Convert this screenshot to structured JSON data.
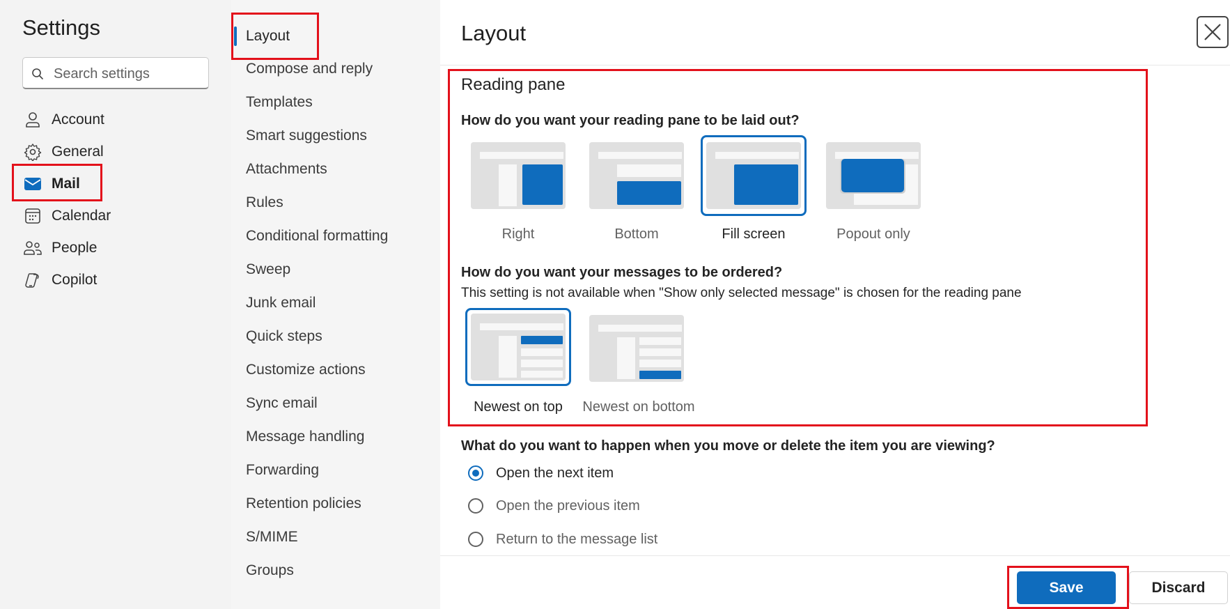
{
  "settings": {
    "title": "Settings",
    "search_placeholder": "Search settings",
    "nav": [
      {
        "label": "Account",
        "icon": "person-icon"
      },
      {
        "label": "General",
        "icon": "gear-icon"
      },
      {
        "label": "Mail",
        "icon": "mail-icon",
        "selected": true
      },
      {
        "label": "Calendar",
        "icon": "calendar-icon"
      },
      {
        "label": "People",
        "icon": "people-icon"
      },
      {
        "label": "Copilot",
        "icon": "copilot-icon"
      }
    ]
  },
  "mail_nav": {
    "items": [
      {
        "label": "Layout",
        "selected": true
      },
      {
        "label": "Compose and reply"
      },
      {
        "label": "Templates"
      },
      {
        "label": "Smart suggestions"
      },
      {
        "label": "Attachments"
      },
      {
        "label": "Rules"
      },
      {
        "label": "Conditional formatting"
      },
      {
        "label": "Sweep"
      },
      {
        "label": "Junk email"
      },
      {
        "label": "Quick steps"
      },
      {
        "label": "Customize actions"
      },
      {
        "label": "Sync email"
      },
      {
        "label": "Message handling"
      },
      {
        "label": "Forwarding"
      },
      {
        "label": "Retention policies"
      },
      {
        "label": "S/MIME"
      },
      {
        "label": "Groups"
      }
    ]
  },
  "main": {
    "title": "Layout",
    "close_icon": "close-icon",
    "reading_pane": {
      "section_title": "Reading pane",
      "layout_question": "How do you want your reading pane to be laid out?",
      "layout_options": [
        {
          "label": "Right",
          "selected": false
        },
        {
          "label": "Bottom",
          "selected": false
        },
        {
          "label": "Fill screen",
          "selected": true
        },
        {
          "label": "Popout only",
          "selected": false
        }
      ],
      "order_question": "How do you want your messages to be ordered?",
      "order_note": "This setting is not available when \"Show only selected message\" is chosen for the reading pane",
      "order_options": [
        {
          "label": "Newest on top",
          "selected": true
        },
        {
          "label": "Newest on bottom",
          "selected": false
        }
      ]
    },
    "move_delete": {
      "question": "What do you want to happen when you move or delete the item you are viewing?",
      "options": [
        {
          "label": "Open the next item",
          "selected": true
        },
        {
          "label": "Open the previous item",
          "selected": false
        },
        {
          "label": "Return to the message list",
          "selected": false
        }
      ]
    },
    "footer": {
      "save_label": "Save",
      "discard_label": "Discard"
    }
  },
  "colors": {
    "accent": "#0f6cbd",
    "highlight_box": "#e3111b"
  }
}
